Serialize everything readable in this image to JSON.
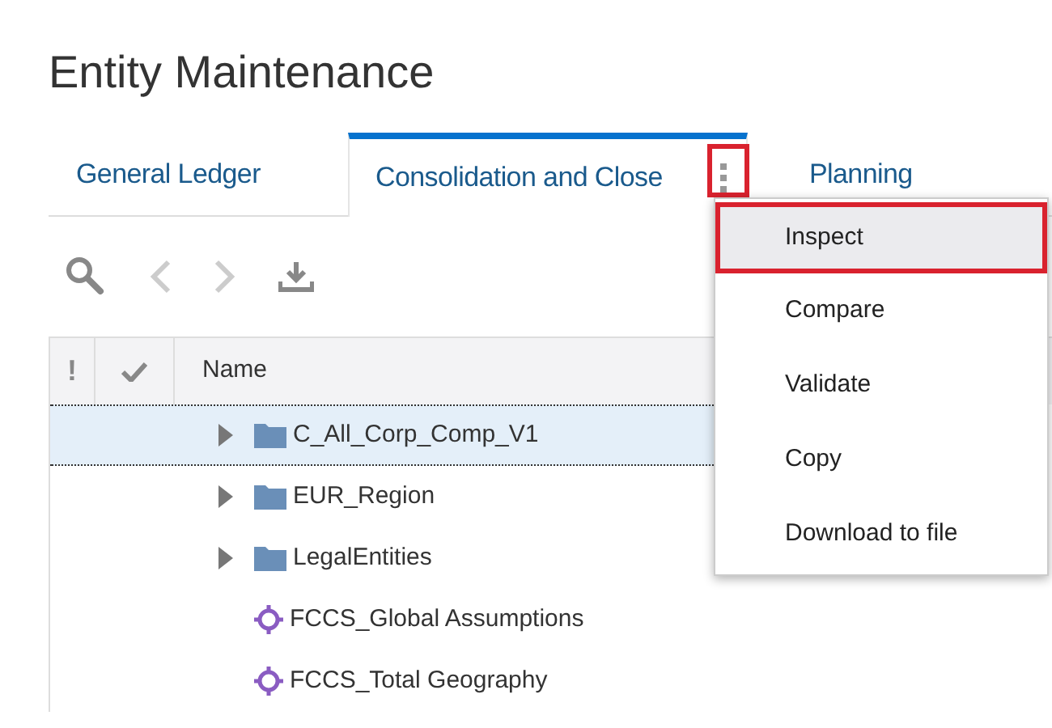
{
  "page_title": "Entity Maintenance",
  "tabs": [
    {
      "label": "General Ledger",
      "selected": false,
      "has_menu": false
    },
    {
      "label": "Consolidation and Close",
      "selected": true,
      "has_menu": true
    },
    {
      "label": "Planning",
      "selected": false,
      "has_menu": false
    }
  ],
  "table": {
    "columns": [
      {
        "kind": "alert",
        "label": "!"
      },
      {
        "kind": "check"
      },
      {
        "kind": "text",
        "label": "Name"
      }
    ],
    "rows": [
      {
        "kind": "folder",
        "name": "C_All_Corp_Comp_V1",
        "expanded": false,
        "selected": true
      },
      {
        "kind": "folder",
        "name": "EUR_Region",
        "expanded": false,
        "selected": false
      },
      {
        "kind": "folder",
        "name": "LegalEntities",
        "expanded": false,
        "selected": false
      },
      {
        "kind": "member",
        "name": "FCCS_Global Assumptions",
        "selected": false
      },
      {
        "kind": "member",
        "name": "FCCS_Total Geography",
        "selected": false
      }
    ]
  },
  "context_menu": {
    "items": [
      {
        "label": "Inspect",
        "selected": true
      },
      {
        "label": "Compare",
        "selected": false
      },
      {
        "label": "Validate",
        "selected": false
      },
      {
        "label": "Copy",
        "selected": false
      },
      {
        "label": "Download to file",
        "selected": false
      }
    ]
  }
}
